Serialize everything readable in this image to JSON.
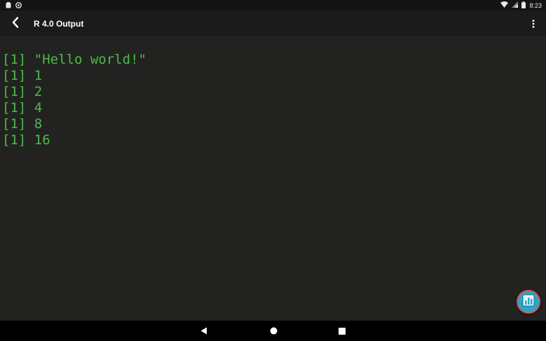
{
  "status_bar": {
    "time": "8:23",
    "icons": [
      "notification-icon",
      "sync-icon",
      "wifi-icon",
      "signal-icon",
      "battery-icon"
    ]
  },
  "app_bar": {
    "title": "R 4.0 Output",
    "back_icon": "chevron-left-icon",
    "menu_icon": "more-vert-icon"
  },
  "console": {
    "lines": [
      "[1] \"Hello world!\"",
      "[1] 1",
      "[1] 2",
      "[1] 4",
      "[1] 8",
      "[1] 16"
    ],
    "text_color": "#4bb948",
    "background": "#222321"
  },
  "fab": {
    "icon": "document-chart-icon",
    "color": "#2aa6c9",
    "border_color": "#d9534f"
  },
  "nav_bar": {
    "buttons": [
      "back-triangle-icon",
      "home-circle-icon",
      "recents-square-icon"
    ]
  }
}
